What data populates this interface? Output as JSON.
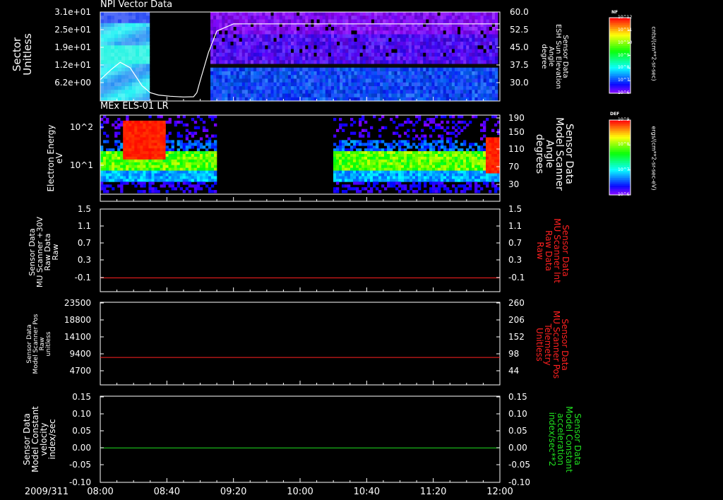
{
  "date_label": "2009/311",
  "colors": {
    "white": "#ffffff",
    "red": "#ff2020",
    "green": "#20e020"
  },
  "chart_data": [
    {
      "type": "heatmap",
      "title": "NPI Vector Data",
      "ylabel_lines": [
        "Sector",
        "Unitless"
      ],
      "y_ticks": [
        "3.1e+01",
        "2.5e+01",
        "1.9e+01",
        "1.2e+01",
        "6.2e+00"
      ],
      "y2label_lines": [
        "Sensor Data",
        "ESH Sun Elevation",
        "Angle",
        "degree"
      ],
      "y2_ticks": [
        "60.0",
        "52.5",
        "45.0",
        "37.5",
        "30.0"
      ],
      "ylim2": [
        22.5,
        60.0
      ],
      "overlay_series": {
        "name": "ESH Sun Elevation Angle",
        "x": [
          "08:00",
          "08:07",
          "08:12",
          "08:18",
          "08:25",
          "08:30",
          "08:35",
          "08:42",
          "08:50",
          "08:56",
          "08:58",
          "09:00",
          "09:05",
          "09:10",
          "09:20",
          "12:00"
        ],
        "values": [
          31.5,
          36.0,
          38.8,
          36.5,
          29.0,
          26.0,
          25.0,
          24.5,
          24.2,
          24.3,
          26.0,
          31.0,
          43.0,
          52.0,
          55.0,
          55.0
        ]
      },
      "colorbar": {
        "title": "NF",
        "ticks": [
          "10^12",
          "10^11",
          "10^10",
          "10^9",
          "10^8",
          "10^7",
          "10^6"
        ],
        "label": "cnts/(cm**2-sr-sec)"
      }
    },
    {
      "type": "heatmap",
      "title": "MEx ELS-01 LR",
      "ylabel_lines": [
        "Electron Energy",
        "eV"
      ],
      "y_ticks": [
        "10^2",
        "10^1"
      ],
      "y2label_lines": [
        "Sensor Data",
        "Model Scanner",
        "Angle",
        "degrees"
      ],
      "y2_ticks": [
        "190",
        "150",
        "110",
        "70",
        "30"
      ],
      "colorbar": {
        "title": "DEF",
        "ticks": [
          "10^9",
          "10^8",
          "10^7",
          "10^6"
        ],
        "label": "ergs/(cm**2-sr-sec-eV)"
      }
    },
    {
      "type": "line",
      "ylabel_lines": [
        "Sensor Data",
        "MU Scanner +30V",
        "Raw Data",
        "Raw"
      ],
      "y_ticks": [
        "1.5",
        "1.1",
        "0.7",
        "0.3",
        "-0.1"
      ],
      "y2label_lines": [
        "Sensor Data",
        "MU Scanner Int",
        "Raw Data",
        "Raw"
      ],
      "y2_ticks": [
        "1.5",
        "1.1",
        "0.7",
        "0.3",
        "-0.1"
      ],
      "ylim": [
        -0.3,
        1.5
      ],
      "series": [
        {
          "x": [
            "08:00",
            "12:00"
          ],
          "values": [
            0.0,
            0.0
          ]
        }
      ]
    },
    {
      "type": "line",
      "ylabel_lines": [
        "Sensor Data",
        "Model Scanner Pos",
        "Raw",
        "unitless"
      ],
      "y_ticks": [
        "23500",
        "18800",
        "14100",
        "9400",
        "4700"
      ],
      "y2label_lines": [
        "Sensor Data",
        "MU Scanner Pos",
        "Telemetry",
        "Unitless"
      ],
      "y2_ticks": [
        "260",
        "206",
        "152",
        "98",
        "44"
      ],
      "ylim": [
        0,
        23500
      ],
      "series": [
        {
          "x": [
            "08:00",
            "12:00"
          ],
          "values": [
            7800,
            7800
          ]
        }
      ]
    },
    {
      "type": "line",
      "ylabel_lines": [
        "Sensor Data",
        "Model Constant",
        "velocity",
        "index/sec"
      ],
      "y_ticks": [
        "0.15",
        "0.10",
        "0.05",
        "0.00",
        "-0.05",
        "-0.10"
      ],
      "y2label_lines": [
        "Sensor Data",
        "Model Constant",
        "acceleration",
        "index/sec**2"
      ],
      "y2_ticks": [
        "0.15",
        "0.10",
        "0.05",
        "0.00",
        "-0.05",
        "-0.10"
      ],
      "ylim": [
        -0.1,
        0.15
      ],
      "series": [
        {
          "x": [
            "08:00",
            "12:00"
          ],
          "values": [
            0.0,
            0.0
          ]
        }
      ]
    }
  ],
  "x_ticks": [
    "08:00",
    "08:40",
    "09:20",
    "10:00",
    "10:40",
    "11:20",
    "12:00"
  ]
}
